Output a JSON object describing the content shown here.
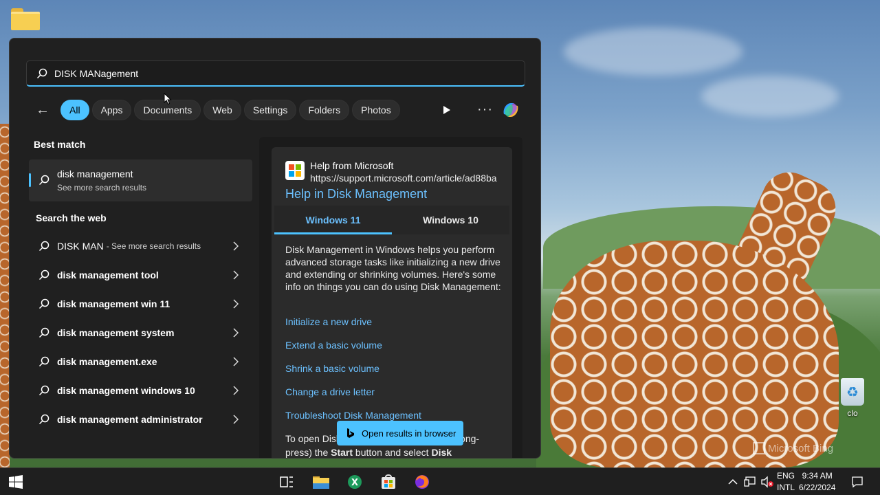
{
  "search": {
    "query": "DISK MANagement",
    "placeholder": ""
  },
  "filters": {
    "items": [
      "All",
      "Apps",
      "Documents",
      "Web",
      "Settings",
      "Folders",
      "Photos"
    ],
    "active": "All"
  },
  "best_match": {
    "heading": "Best match",
    "title": "disk management",
    "subtitle": "See more search results"
  },
  "search_web": {
    "heading": "Search the web",
    "items": [
      {
        "text": "DISK MAN",
        "sub": "- See more search results"
      },
      {
        "text": "disk management tool",
        "sub": ""
      },
      {
        "text": "disk management win 11",
        "sub": ""
      },
      {
        "text": "disk management system",
        "sub": ""
      },
      {
        "text": "disk management.exe",
        "sub": ""
      },
      {
        "text": "disk management windows 10",
        "sub": ""
      },
      {
        "text": "disk management administrator",
        "sub": ""
      }
    ]
  },
  "preview": {
    "source": "Help from Microsoft",
    "url": "https://support.microsoft.com/article/ad88ba",
    "title": "Help in Disk Management",
    "tabs": [
      "Windows 11",
      "Windows 10"
    ],
    "active_tab": "Windows 11",
    "description": "Disk Management in Windows helps you perform advanced storage tasks like initializing a new drive and extending or shrinking volumes. Here's some info on things you can do using Disk Management:",
    "links": [
      "Initialize a new drive",
      "Extend a basic volume",
      "Shrink a basic volume",
      "Change a drive letter",
      "Troubleshoot Disk Management"
    ],
    "instruction_start": "To open Disk",
    "instruction_mid": "long-",
    "instruction_line2_a": "press) the ",
    "instruction_bold1": "Start",
    "instruction_line2_b": " button and select ",
    "instruction_bold2": "Disk"
  },
  "open_browser": {
    "label": "Open results in browser"
  },
  "desktop": {
    "recycle_label": "clo",
    "watermark": "Microsoft Bing"
  },
  "taskbar": {
    "lang_1": "ENG",
    "lang_2": "INTL",
    "time": "9:34 AM",
    "date": "6/22/2024"
  },
  "colors": {
    "accent": "#4cc2ff",
    "panel": "#202020",
    "link": "#6cc1ff"
  }
}
